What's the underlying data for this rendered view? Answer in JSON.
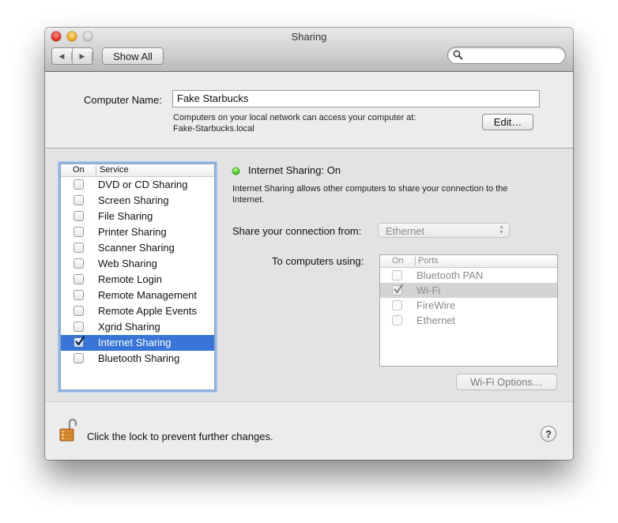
{
  "window": {
    "title": "Sharing",
    "back_icon": "triangle-left",
    "forward_icon": "triangle-right",
    "show_all_label": "Show All",
    "search": {
      "value": "",
      "placeholder": ""
    }
  },
  "computer_name": {
    "label": "Computer Name:",
    "value": "Fake Starbucks",
    "help_line1": "Computers on your local network can access your computer at:",
    "help_line2": "Fake-Starbucks.local",
    "edit_label": "Edit…"
  },
  "services": {
    "header_on": "On",
    "header_service": "Service",
    "items": [
      {
        "label": "DVD or CD Sharing",
        "checked": false,
        "selected": false
      },
      {
        "label": "Screen Sharing",
        "checked": false,
        "selected": false
      },
      {
        "label": "File Sharing",
        "checked": false,
        "selected": false
      },
      {
        "label": "Printer Sharing",
        "checked": false,
        "selected": false
      },
      {
        "label": "Scanner Sharing",
        "checked": false,
        "selected": false
      },
      {
        "label": "Web Sharing",
        "checked": false,
        "selected": false
      },
      {
        "label": "Remote Login",
        "checked": false,
        "selected": false
      },
      {
        "label": "Remote Management",
        "checked": false,
        "selected": false
      },
      {
        "label": "Remote Apple Events",
        "checked": false,
        "selected": false
      },
      {
        "label": "Xgrid Sharing",
        "checked": false,
        "selected": false
      },
      {
        "label": "Internet Sharing",
        "checked": true,
        "selected": true
      },
      {
        "label": "Bluetooth Sharing",
        "checked": false,
        "selected": false
      }
    ]
  },
  "detail": {
    "status_text": "Internet Sharing: On",
    "status_color": "#39c21a",
    "description_line1": "Internet Sharing allows other computers to share your connection to the",
    "description_line2": "Internet.",
    "share_from_label": "Share your connection from:",
    "share_from_value": "Ethernet",
    "to_computers_label": "To computers using:",
    "ports_header_on": "On",
    "ports_header_ports": "Ports",
    "ports": [
      {
        "label": "Bluetooth PAN",
        "checked": false,
        "selected": false
      },
      {
        "label": "Wi-Fi",
        "checked": true,
        "selected": true
      },
      {
        "label": "FireWire",
        "checked": false,
        "selected": false
      },
      {
        "label": "Ethernet",
        "checked": false,
        "selected": false
      }
    ],
    "wifi_options_label": "Wi-Fi Options…"
  },
  "footer": {
    "lock_text": "Click the lock to prevent further changes.",
    "lock_state": "unlocked",
    "help_label": "?"
  },
  "colors": {
    "selection": "#3875d7",
    "focus_ring": "#8db2e3"
  }
}
